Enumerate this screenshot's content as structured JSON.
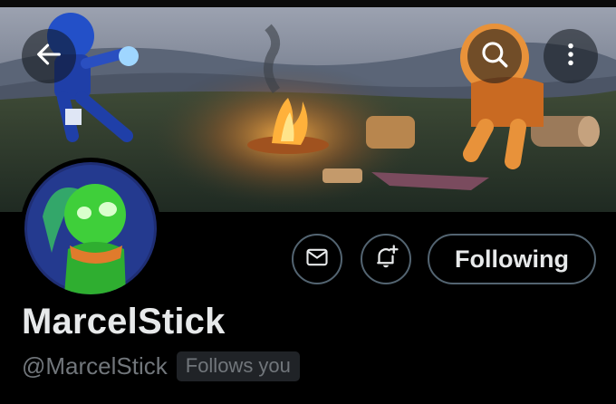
{
  "banner": {
    "description_icon": "campfire-scene"
  },
  "nav": {
    "back_icon": "arrow-left-icon",
    "search_icon": "search-icon",
    "more_icon": "more-vertical-icon"
  },
  "actions": {
    "message_icon": "envelope-icon",
    "notify_icon": "bell-plus-icon",
    "follow_label": "Following"
  },
  "profile": {
    "display_name": "MarcelStick",
    "handle": "@MarcelStick",
    "follows_you": "Follows you"
  },
  "colors": {
    "background": "#000000",
    "text_primary": "#e7e9ea",
    "text_secondary": "#71767b",
    "border": "#536471",
    "badge_bg": "#202327"
  }
}
